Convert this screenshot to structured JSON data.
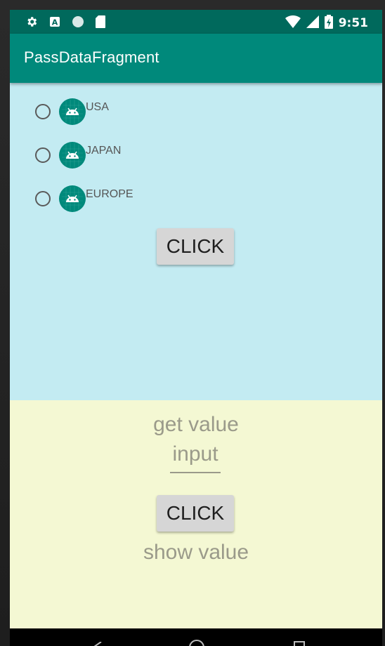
{
  "status_bar": {
    "time": "9:51",
    "icons_left": [
      "gear-icon",
      "a-icon",
      "circle-icon",
      "sd-card-icon"
    ],
    "icons_right": [
      "wifi-icon",
      "cell-signal-icon",
      "battery-charging-icon"
    ]
  },
  "app_bar": {
    "title": "PassDataFragment"
  },
  "top_fragment": {
    "radio_options": [
      {
        "label": "USA"
      },
      {
        "label": "JAPAN"
      },
      {
        "label": "EUROPE"
      }
    ],
    "click_label": "CLICK",
    "background": "#c3ebf2"
  },
  "bottom_fragment": {
    "get_value_text": "get value",
    "input_placeholder": "input",
    "click_label": "CLICK",
    "show_value_text": "show value",
    "background": "#f4f8d3"
  },
  "colors": {
    "status_bar": "#00695c",
    "app_bar": "#00897b",
    "android_icon": "#00897b"
  }
}
